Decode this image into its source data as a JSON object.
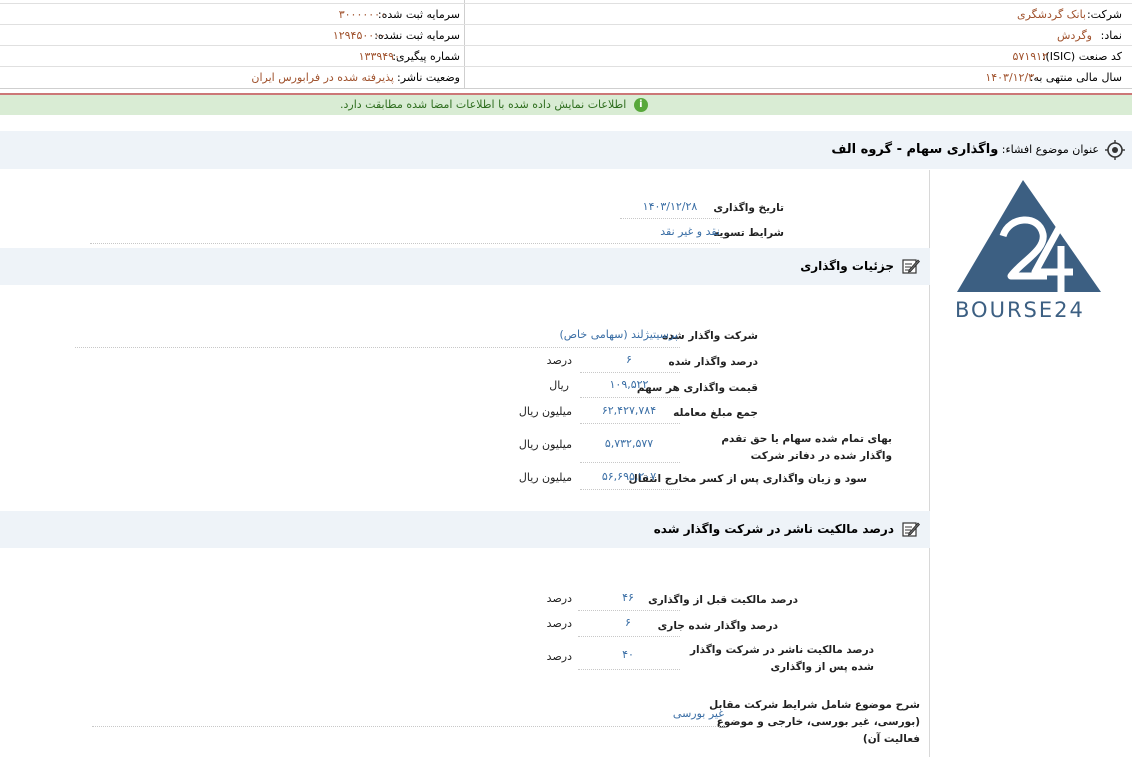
{
  "header": {
    "company_label": "شرکت:",
    "company_value": "بانک گردشگری",
    "capital_registered_label": "سرمایه ثبت شده:",
    "capital_registered_value": "۳۰۰۰۰۰۰۰",
    "symbol_label": "نماد:",
    "symbol_value": "وگردش",
    "capital_unregistered_label": "سرمایه ثبت نشده:",
    "capital_unregistered_value": "۱۲۹۴۵۰۰۰۰",
    "isic_label": "کد صنعت (ISIC):",
    "isic_value": "۵۷۱۹۱۲",
    "tracking_label": "شماره پیگیری:",
    "tracking_value": "۱۳۳۹۴۹۰",
    "fiscal_label": "سال مالی منتهی به:",
    "fiscal_value": "۱۴۰۳/۱۲/۳۰",
    "status_label": "وضعیت ناشر:",
    "status_value": "پذیرفته شده در فرابورس ایران"
  },
  "notice": {
    "text": "اطلاعات نمایش داده شده با اطلاعات امضا شده مطابقت دارد.",
    "icon": "info-icon"
  },
  "subject": {
    "label": "عنوان موضوع افشاء:",
    "value": "واگذاری سهام - گروه الف"
  },
  "general": {
    "date_label": "تاریخ واگذاری",
    "date_value": "۱۴۰۳/۱۲/۲۸",
    "settlement_label": "شرایط تسویه",
    "settlement_value": "نقد و غیر نقد"
  },
  "details": {
    "title": "جزئیات واگذاری",
    "rows": [
      {
        "label": "شرکت واگذار شده",
        "value": "پرسیتیژلند (سهامی خاص)",
        "unit": ""
      },
      {
        "label": "درصد واگذار شده",
        "value": "۶",
        "unit": "درصد"
      },
      {
        "label": "قیمت واگذاری هر سهم",
        "value": "۱۰۹,۵۲۲",
        "unit": "ریال"
      },
      {
        "label": "جمع مبلغ معامله",
        "value": "۶۲,۴۲۷,۷۸۴",
        "unit": "میلیون ریال"
      },
      {
        "label": "بهای تمام شده سهام یا حق تقدم واگذار شده در دفاتر شرکت",
        "value": "۵,۷۳۲,۵۷۷",
        "unit": "میلیون ریال"
      },
      {
        "label": "سود و زیان واگذاری پس از کسر مخارج انتقال",
        "value": "۵۶,۶۹۵,۲۰۷",
        "unit": "میلیون ریال"
      }
    ]
  },
  "ownership": {
    "title": "درصد مالکیت ناشر در شرکت واگذار شده",
    "rows": [
      {
        "label": "درصد مالکیت قبل از واگذاری",
        "value": "۴۶",
        "unit": "درصد"
      },
      {
        "label": "درصد واگذار شده جاری",
        "value": "۶",
        "unit": "درصد"
      },
      {
        "label": "درصد مالکیت ناشر در شرکت واگذار شده پس از واگذاری",
        "value": "۴۰",
        "unit": "درصد"
      }
    ],
    "desc_label": "شرح موضوع شامل شرایط شرکت مقابل (بورسی، غیر بورسی، خارجی و موضوع فعالیت آن)",
    "desc_value": "غیر بورسی"
  },
  "logo": {
    "text": "BOURSE24",
    "color": "#3c5f82"
  }
}
